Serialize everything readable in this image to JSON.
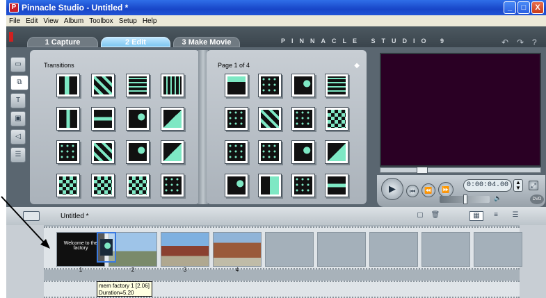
{
  "window": {
    "title": "Pinnacle Studio - Untitled *",
    "minimize": "_",
    "maximize": "□",
    "close": "X"
  },
  "menu": [
    "File",
    "Edit",
    "View",
    "Album",
    "Toolbox",
    "Setup",
    "Help"
  ],
  "tabs": [
    {
      "label": "1 Capture"
    },
    {
      "label": "2 Edit"
    },
    {
      "label": "3 Make Movie"
    }
  ],
  "brand": "PINNACLE STUDIO 9",
  "album": {
    "left_label": "Transitions",
    "right_label": "Page 1 of 4"
  },
  "player": {
    "timecode": "0:00:04.00",
    "dvd": "DVD"
  },
  "movie": {
    "title": "Untitled *",
    "clips": [
      {
        "num": "1",
        "caption": "Welcome to the factory"
      },
      {
        "num": "2",
        "caption": ""
      },
      {
        "num": "3",
        "caption": ""
      },
      {
        "num": "4",
        "caption": ""
      }
    ],
    "tooltip_line1": "mem factory 1 [2.06]",
    "tooltip_line2": "Duration=5.20"
  }
}
